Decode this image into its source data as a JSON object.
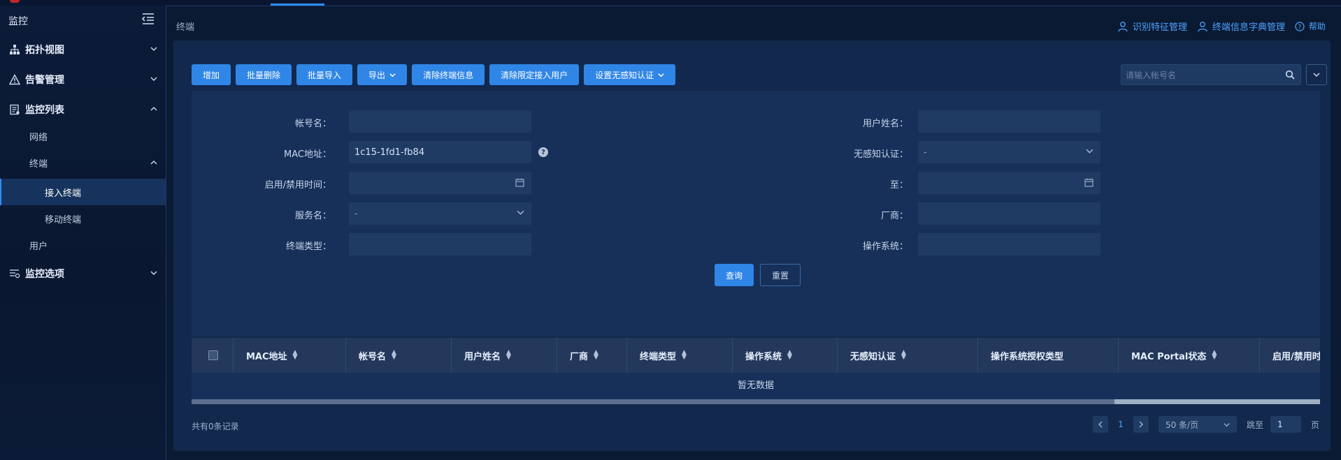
{
  "sidebar": {
    "title": "监控",
    "items": [
      {
        "label": "拓扑视图"
      },
      {
        "label": "告警管理"
      },
      {
        "label": "监控列表"
      },
      {
        "label": "网络"
      },
      {
        "label": "终端"
      },
      {
        "label": "接入终端"
      },
      {
        "label": "移动终端"
      },
      {
        "label": "用户"
      },
      {
        "label": "监控选项"
      }
    ]
  },
  "header": {
    "breadcrumb": "终端",
    "links": [
      "识别特征管理",
      "终端信息字典管理",
      "帮助"
    ]
  },
  "toolbar": {
    "buttons": [
      "增加",
      "批量删除",
      "批量导入",
      "导出",
      "清除终端信息",
      "清除限定接入用户",
      "设置无感知认证"
    ],
    "search_placeholder": "请输入帐号名"
  },
  "form": {
    "account_label": "帐号名：",
    "username_label": "用户姓名：",
    "mac_label": "MAC地址：",
    "mac_value": "1c15-1fd1-fb84",
    "noauth_label": "无感知认证：",
    "noauth_value": "-",
    "time_label": "启用/禁用时间：",
    "to_label": "至：",
    "service_label": "服务名：",
    "service_value": "-",
    "vendor_label": "厂商：",
    "type_label": "终端类型：",
    "os_label": "操作系统：",
    "query": "查询",
    "reset": "重置"
  },
  "table": {
    "columns": [
      "MAC地址",
      "帐号名",
      "用户姓名",
      "厂商",
      "终端类型",
      "操作系统",
      "无感知认证",
      "操作系统授权类型",
      "MAC Portal状态",
      "启用/禁用时"
    ],
    "empty_text": "暂无数据"
  },
  "footer": {
    "total": "共有0条记录",
    "current_page": "1",
    "page_size": "50 条/页",
    "jump_label": "跳至",
    "jump_value": "1",
    "page_suffix": "页"
  },
  "colors": {
    "accent": "#2f86e6",
    "link": "#4da3ff",
    "background": "#0b1a33",
    "panel": "#12294d"
  }
}
